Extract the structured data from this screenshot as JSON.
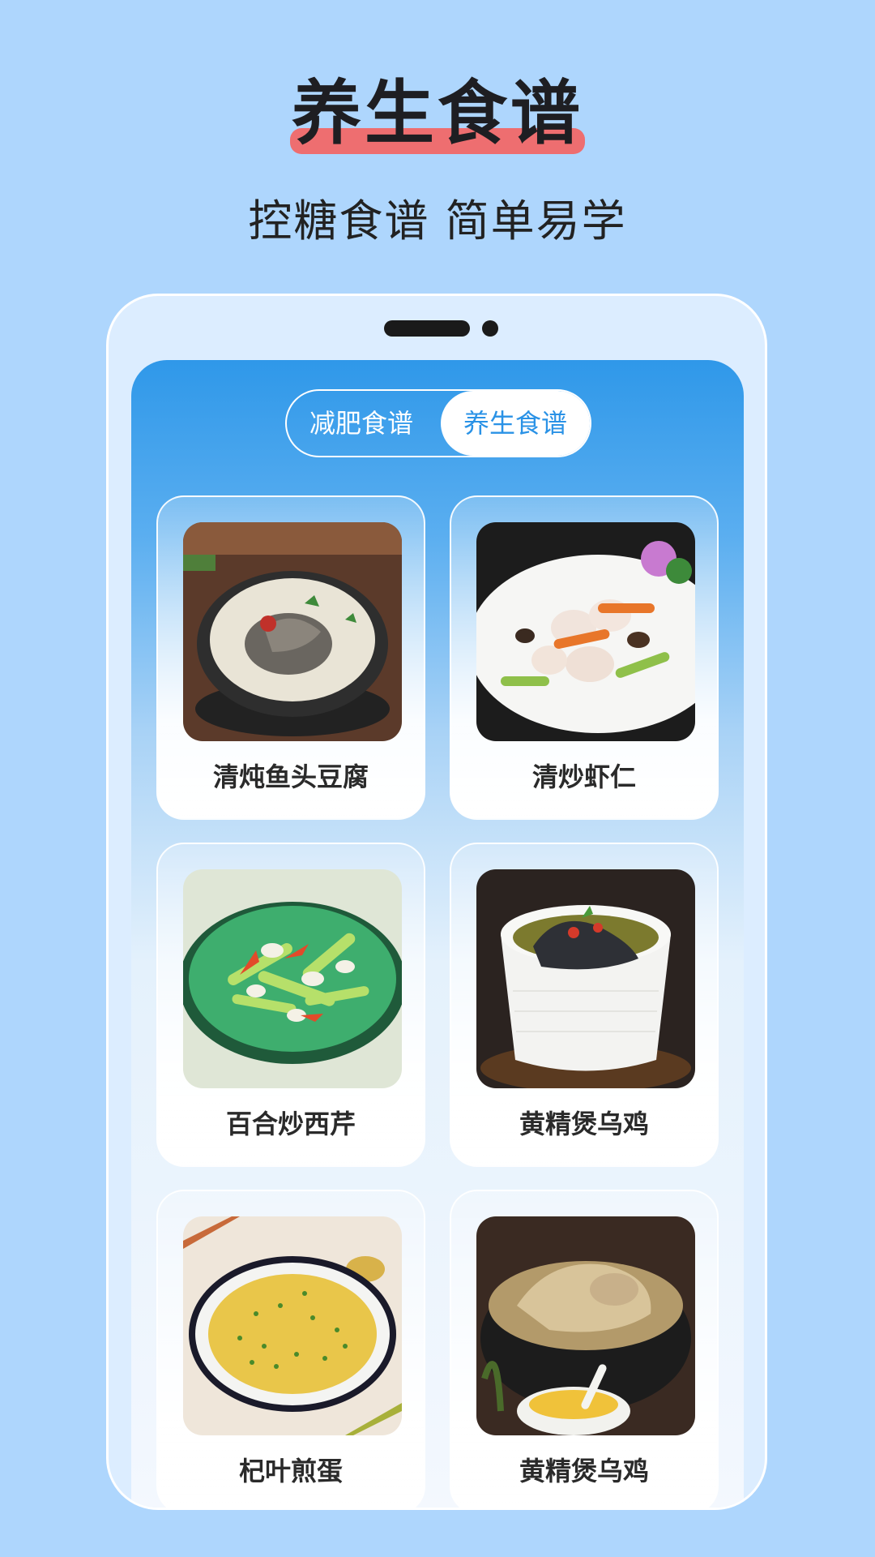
{
  "header": {
    "title": "养生食谱",
    "subtitle": "控糖食谱 简单易学"
  },
  "tabs": [
    {
      "label": "减肥食谱",
      "active": false
    },
    {
      "label": "养生食谱",
      "active": true
    }
  ],
  "recipes": [
    {
      "name": "清炖鱼头豆腐",
      "icon": "fish-head-tofu-photo"
    },
    {
      "name": "清炒虾仁",
      "icon": "shrimp-photo"
    },
    {
      "name": "百合炒西芹",
      "icon": "lily-celery-photo"
    },
    {
      "name": "黄精煲乌鸡",
      "icon": "black-chicken-soup-photo"
    },
    {
      "name": "杞叶煎蛋",
      "icon": "omelette-photo"
    },
    {
      "name": "黄精煲乌鸡",
      "icon": "chicken-pot-photo"
    }
  ],
  "colors": {
    "background": "#aed6fd",
    "accent": "#2a92e6",
    "title_underline": "#ee6e70"
  }
}
